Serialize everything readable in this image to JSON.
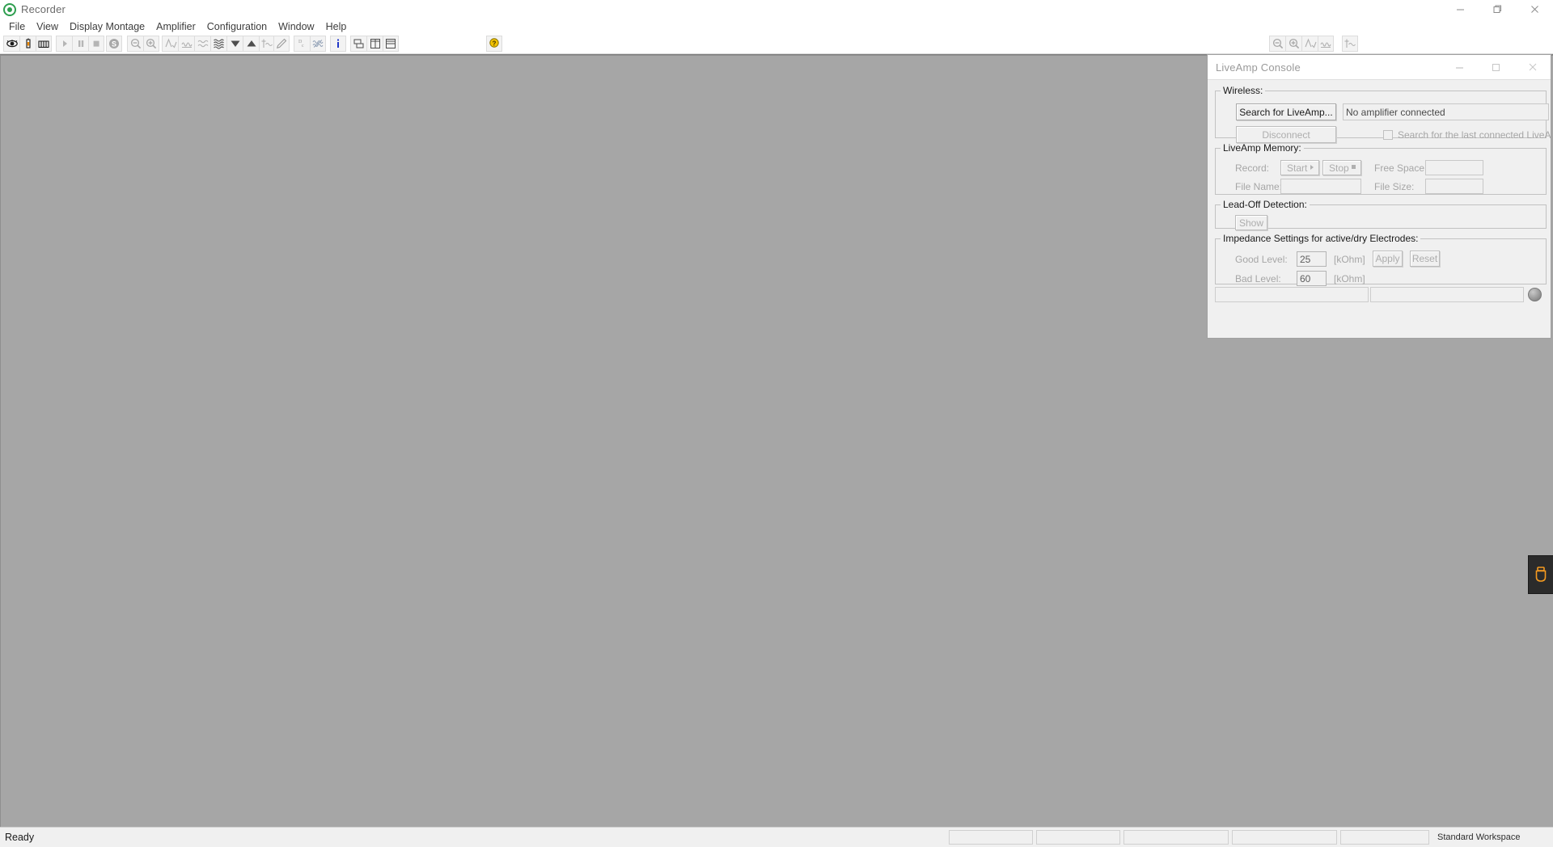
{
  "window": {
    "title": "Recorder",
    "app_icon": "recorder-logo-icon",
    "minimize": "—",
    "maximize": "□",
    "close": "✕"
  },
  "menubar": {
    "items": [
      {
        "label": "File"
      },
      {
        "label": "View"
      },
      {
        "label": "Display Montage"
      },
      {
        "label": "Amplifier"
      },
      {
        "label": "Configuration"
      },
      {
        "label": "Window"
      },
      {
        "label": "Help"
      }
    ]
  },
  "toolbar": {
    "left_groups": [
      {
        "buttons": [
          {
            "icon": "eye-monitoring-icon",
            "enabled": true
          },
          {
            "icon": "impedance-check-icon",
            "enabled": true
          },
          {
            "icon": "test-signal-icon",
            "enabled": true
          }
        ]
      },
      {
        "buttons": [
          {
            "icon": "play-record-icon",
            "enabled": false
          },
          {
            "icon": "pause-icon",
            "enabled": false
          },
          {
            "icon": "stop-icon",
            "enabled": false
          }
        ]
      },
      {
        "buttons": [
          {
            "icon": "sync-s-icon",
            "enabled": false
          }
        ]
      },
      {
        "buttons": [
          {
            "icon": "zoom-out-icon",
            "enabled": false
          },
          {
            "icon": "zoom-in-icon",
            "enabled": false
          }
        ]
      },
      {
        "buttons": [
          {
            "icon": "scale-amplitude-icon",
            "enabled": false
          },
          {
            "icon": "timebase-icon",
            "enabled": false
          },
          {
            "icon": "dc-offset-icon",
            "enabled": false
          },
          {
            "icon": "channel-overlay-icon",
            "enabled": false
          },
          {
            "icon": "scroll-down-icon",
            "enabled": false
          },
          {
            "icon": "scroll-up-icon",
            "enabled": false
          },
          {
            "icon": "baseline-correction-icon",
            "enabled": false
          }
        ]
      },
      {
        "buttons": [
          {
            "icon": "marker-pen-icon",
            "enabled": false
          }
        ]
      },
      {
        "buttons": [
          {
            "icon": "dc-coupling-icon",
            "enabled": false
          },
          {
            "icon": "filter-icon",
            "enabled": false
          }
        ]
      },
      {
        "buttons": [
          {
            "icon": "info-icon",
            "enabled": true
          }
        ]
      },
      {
        "buttons": [
          {
            "icon": "tile-windows-icon",
            "enabled": true
          },
          {
            "icon": "split-vertical-icon",
            "enabled": true
          },
          {
            "icon": "split-horizontal-icon",
            "enabled": true
          }
        ]
      },
      {
        "buttons": [
          {
            "icon": "help-question-icon",
            "enabled": true
          }
        ]
      }
    ],
    "right_groups": [
      {
        "buttons": [
          {
            "icon": "zoom-out-icon",
            "enabled": false
          },
          {
            "icon": "zoom-in-icon",
            "enabled": false
          },
          {
            "icon": "scale-amplitude-icon",
            "enabled": false
          },
          {
            "icon": "timebase-icon",
            "enabled": false
          }
        ]
      },
      {
        "buttons": [
          {
            "icon": "baseline-correction-icon",
            "enabled": false
          }
        ]
      }
    ]
  },
  "usb_tab": {
    "icon": "usb-device-icon",
    "color": "#f49a20"
  },
  "statusbar": {
    "message": "Ready",
    "panes": [
      "",
      "",
      "",
      "",
      ""
    ],
    "workspace": "Standard Workspace"
  },
  "dialog": {
    "title": "LiveAmp Console",
    "minimize": "—",
    "maximize": "□",
    "close": "✕",
    "wireless": {
      "legend": "Wireless:",
      "search_button": "Search for LiveAmp...",
      "disconnect_button": "Disconnect",
      "status_value": "No amplifier connected",
      "last_connected_label": "Search for the last connected LiveAmp",
      "last_connected_checked": false
    },
    "memory": {
      "legend": "LiveAmp Memory:",
      "record_label": "Record:",
      "start_button": "Start",
      "stop_button": "Stop",
      "free_space_label": "Free Space:",
      "free_space_value": "",
      "file_name_label": "File Name:",
      "file_name_value": "",
      "file_size_label": "File Size:",
      "file_size_value": ""
    },
    "leadoff": {
      "legend": "Lead-Off Detection:",
      "show_button": "Show"
    },
    "impedance": {
      "legend": "Impedance Settings for active/dry Electrodes:",
      "good_level_label": "Good Level:",
      "good_level_value": "25",
      "good_level_unit": "[kOhm]",
      "bad_level_label": "Bad Level:",
      "bad_level_value": "60",
      "bad_level_unit": "[kOhm]",
      "apply_button": "Apply",
      "reset_button": "Reset"
    },
    "footer": {
      "pane_left": "",
      "pane_right": "",
      "led": "status-led"
    }
  }
}
